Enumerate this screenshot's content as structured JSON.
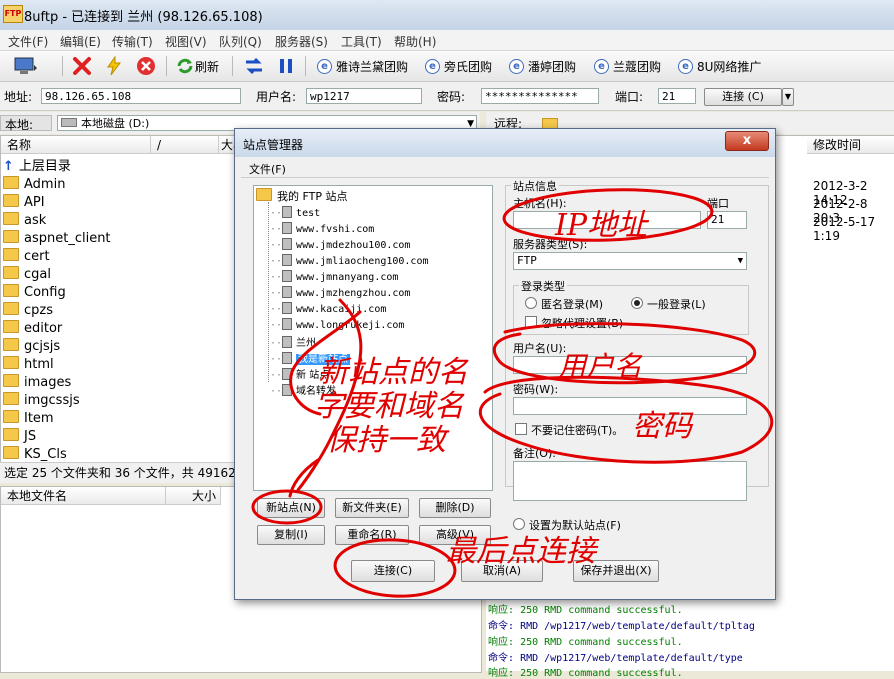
{
  "window": {
    "app_icon_text": "FTP",
    "title": "8uftp - 已连接到 兰州 (98.126.65.108)"
  },
  "menu": [
    "文件(F)",
    "编辑(E)",
    "传输(T)",
    "视图(V)",
    "队列(Q)",
    "服务器(S)",
    "工具(T)",
    "帮助(H)"
  ],
  "toolbar": {
    "refresh_label": "刷新",
    "links": [
      "雅诗兰黛团购",
      "旁氏团购",
      "潘婷团购",
      "兰蔻团购",
      "8U网络推广"
    ]
  },
  "address_bar": {
    "address_label": "地址:",
    "address_value": "98.126.65.108",
    "user_label": "用户名:",
    "user_value": "wp1217",
    "password_label": "密码:",
    "password_value": "**************",
    "port_label": "端口:",
    "port_value": "21",
    "connect_label": "连接 (C)"
  },
  "local": {
    "label": "本地:",
    "path": "本地磁盘 (D:)",
    "col_name": "名称",
    "col_sort": "/",
    "col_size": "大小",
    "files": [
      {
        "name": "上层目录"
      },
      {
        "name": "Admin"
      },
      {
        "name": "API"
      },
      {
        "name": "ask"
      },
      {
        "name": "aspnet_client"
      },
      {
        "name": "cert"
      },
      {
        "name": "cgal"
      },
      {
        "name": "Config"
      },
      {
        "name": "cpzs"
      },
      {
        "name": "editor"
      },
      {
        "name": "gcjsjs"
      },
      {
        "name": "html"
      },
      {
        "name": "images"
      },
      {
        "name": "imgcssjs"
      },
      {
        "name": "Item"
      },
      {
        "name": "JS"
      },
      {
        "name": "KS_Cls"
      }
    ],
    "status": "选定 25 个文件夹和 36 个文件，共 49162",
    "queue_col_name": "本地文件名",
    "queue_col_size": "大小"
  },
  "remote": {
    "label": "远程:",
    "col_modified": "修改时间",
    "dates": [
      "2012-3-2 14:12",
      "2012-2-8 20:3",
      "2012-5-17 1:19"
    ]
  },
  "log": [
    {
      "type": "响应:",
      "text": "250 RMD command successful."
    },
    {
      "type": "命令:",
      "text": "RMD /wp1217/web/template/default/tpltag"
    },
    {
      "type": "响应:",
      "text": "250 RMD command successful."
    },
    {
      "type": "命令:",
      "text": "RMD /wp1217/web/template/default/type"
    },
    {
      "type": "响应:",
      "text": "250 RMD command successful."
    }
  ],
  "dialog": {
    "title": "站点管理器",
    "close_label": "x",
    "menu_file": "文件(F)",
    "tree_root": "我的 FTP 站点",
    "sites": [
      "test",
      "www.fvshi.com",
      "www.jmdezhou100.com",
      "www.jmliaocheng100.com",
      "www.jmnanyang.com",
      "www.jmzhengzhou.com",
      "www.kacaiji.com",
      "www.longrukeji.com",
      "兰州",
      "我是新站点",
      "新 站点",
      "域名转发"
    ],
    "site_info_label": "站点信息",
    "host_label": "主机名(H):",
    "port_label": "端口",
    "port_value": "21",
    "server_type_label": "服务器类型(S):",
    "server_type_value": "FTP",
    "login_type_label": "登录类型",
    "anon_login": "匿名登录(M)",
    "normal_login": "一般登录(L)",
    "ignore_proxy": "忽略代理设置(B)",
    "username_label": "用户名(U):",
    "password_label": "密码(W):",
    "no_remember": "不要记住密码(T)。",
    "notes_label": "备注(O):",
    "set_default": "设置为默认站点(F)",
    "buttons": {
      "new_site": "新站点(N)",
      "new_folder": "新文件夹(E)",
      "delete": "删除(D)",
      "copy": "复制(I)",
      "rename": "重命名(R)",
      "advanced": "高级(V)",
      "connect": "连接(C)",
      "cancel": "取消(A)",
      "save_exit": "保存并退出(X)"
    }
  },
  "annotations": {
    "ip": "IP地址",
    "user": "用户名",
    "password": "密码",
    "site_name_1": "新站点的名",
    "site_name_2": "字要和域名",
    "site_name_3": "保持一致",
    "connect_last": "最后点连接"
  },
  "colors": {
    "annotation": "#e00000",
    "selection": "#3399ff"
  }
}
